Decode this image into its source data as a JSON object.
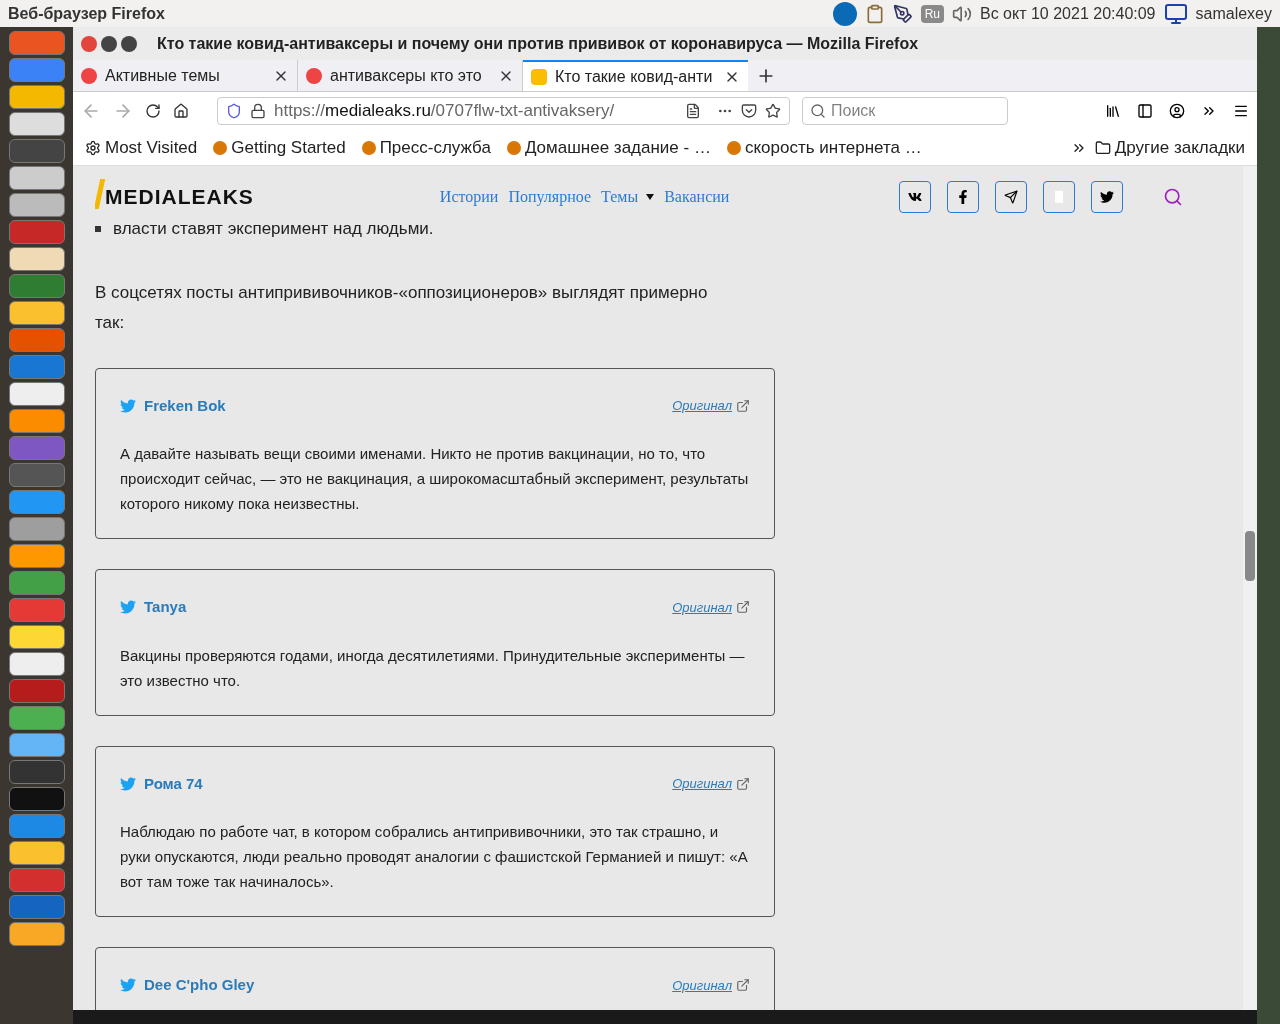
{
  "top_bar": {
    "app_title": "Веб-браузер Firefox",
    "indicators": [
      "Ru"
    ],
    "clock": "Вс окт 10 2021 20:40:09",
    "user": "samalexey"
  },
  "window": {
    "title": "Кто такие ковид-антиваксеры и почему они против прививок от коронавируса — Mozilla Firefox"
  },
  "tabs": [
    {
      "label": "Активные темы",
      "selected": false
    },
    {
      "label": "антиваксеры кто это",
      "selected": false
    },
    {
      "label": "Кто такие ковид-анти",
      "selected": true
    }
  ],
  "address_bar": {
    "scheme": "https://",
    "domain": "medialeaks.ru",
    "path": "/0707flw-txt-antivaksery/"
  },
  "search": {
    "placeholder": "Поиск"
  },
  "bookmarks": [
    "Most Visited",
    "Getting Started",
    "Пресс-служба",
    "Домашнее задание - …",
    "скорость интернета …"
  ],
  "other_bookmarks": "Другие закладки",
  "site": {
    "logo": "MEDIALEAKS",
    "nav": [
      "Истории",
      "Популярное",
      "Темы",
      "Вакансии"
    ]
  },
  "article": {
    "bullet": "власти ставят эксперимент над людьми.",
    "paragraph": "В соцсетях посты антипрививочников-«оппозиционеров» выглядят примерно так:"
  },
  "tweets": [
    {
      "author": "Freken Bok",
      "link": "Оригинал",
      "text": "А давайте называть вещи своими именами. Никто не против вакцинации, но то, что происходит сейчас, — это не вакцинация, а широкомасштабный эксперимент, результаты которого никому пока неизвестны."
    },
    {
      "author": "Tanya",
      "link": "Оригинал",
      "text": "Вакцины проверяются годами, иногда десятилетиями. Принудительные эксперименты — это известно что."
    },
    {
      "author": "Рома 74",
      "link": "Оригинал",
      "text": "Наблюдаю по работе чат, в котором собрались антипрививочники, это так страшно, и руки опускаются, люди реально проводят аналогии с фашистской Германией и пишут: «А вот там тоже так начиналось»."
    },
    {
      "author": "Dee C'pho Gley",
      "link": "Оригинал"
    }
  ]
}
